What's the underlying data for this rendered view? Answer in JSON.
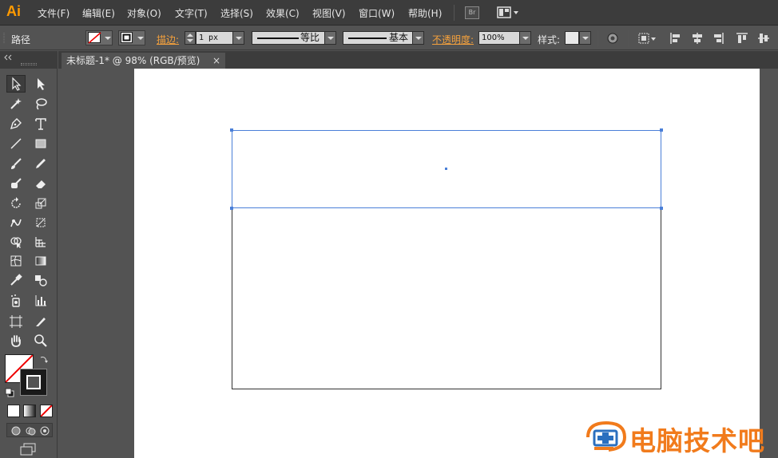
{
  "app": {
    "logo": "Ai"
  },
  "menu": {
    "items": [
      "文件(F)",
      "编辑(E)",
      "对象(O)",
      "文字(T)",
      "选择(S)",
      "效果(C)",
      "视图(V)",
      "窗口(W)",
      "帮助(H)"
    ],
    "bridge_label": "Br"
  },
  "control_bar": {
    "selection_label": "路径",
    "stroke_label": "描边:",
    "stroke_weight": "1 px",
    "stroke_profile_label": "等比",
    "brush_label": "基本",
    "opacity_label": "不透明度:",
    "opacity_value": "100%",
    "style_label": "样式:"
  },
  "document": {
    "tab_title": "未标题-1* @ 98% (RGB/预览)",
    "close_glyph": "×"
  },
  "watermark": {
    "text": "电脑技术吧"
  },
  "colors": {
    "accent": "#ff9a00",
    "selection": "#4a7fd8",
    "watermark": "#f17b1c"
  }
}
